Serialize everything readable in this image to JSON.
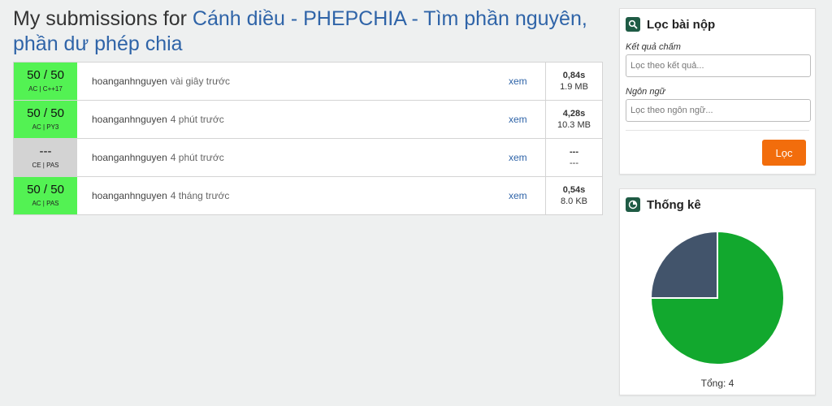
{
  "page": {
    "title_prefix": "My submissions for",
    "problem_name": "Cánh diều - PHEPCHIA - Tìm phần nguyên, phần dư phép chia"
  },
  "submissions": [
    {
      "points": "50 / 50",
      "result": "AC | C++17",
      "user": "hoanganhnguyen",
      "time_ago": "vài giây trước",
      "view": "xem",
      "time": "0,84s",
      "memory": "1.9 MB"
    },
    {
      "points": "50 / 50",
      "result": "AC | PY3",
      "user": "hoanganhnguyen",
      "time_ago": "4 phút trước",
      "view": "xem",
      "time": "4,28s",
      "memory": "10.3 MB"
    },
    {
      "points": "---",
      "result": "CE | PAS",
      "user": "hoanganhnguyen",
      "time_ago": "4 phút trước",
      "view": "xem",
      "time": "---",
      "memory": "---"
    },
    {
      "points": "50 / 50",
      "result": "AC | PAS",
      "user": "hoanganhnguyen",
      "time_ago": "4 tháng trước",
      "view": "xem",
      "time": "0,54s",
      "memory": "8.0 KB"
    }
  ],
  "filter": {
    "title": "Lọc bài nộp",
    "icon": "search-icon",
    "result_label": "Kết quả chấm",
    "result_placeholder": "Lọc theo kết quả...",
    "language_label": "Ngôn ngữ",
    "language_placeholder": "Lọc theo ngôn ngữ...",
    "button": "Lọc"
  },
  "stats": {
    "title": "Thống kê",
    "icon": "pie-chart-icon",
    "total_label": "Tổng: 4"
  },
  "chart_data": {
    "type": "pie",
    "values": [
      3,
      1
    ],
    "colors": [
      "#12a82e",
      "#42546b"
    ]
  },
  "colors": {
    "accepted": "#53f253",
    "compile_error": "#d3d3d3",
    "link": "#2f64a8",
    "button": "#f26d0c"
  }
}
